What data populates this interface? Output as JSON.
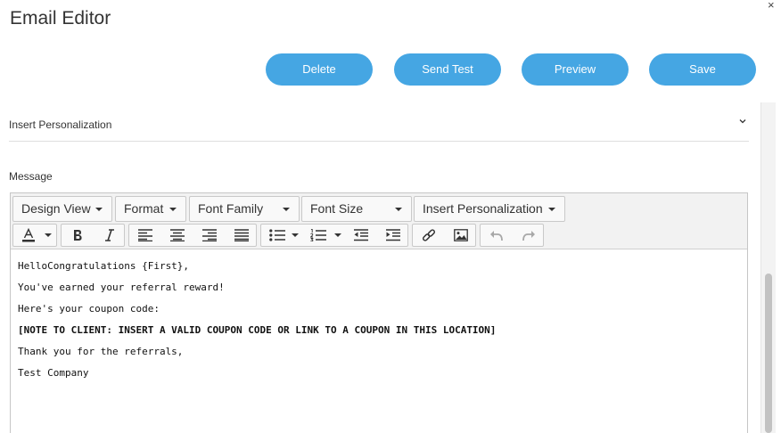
{
  "header": {
    "title": "Email Editor",
    "close_glyph": "×"
  },
  "actions": {
    "delete_label": "Delete",
    "send_test_label": "Send Test",
    "preview_label": "Preview",
    "save_label": "Save"
  },
  "personalization_panel": {
    "label": "Insert Personalization"
  },
  "message": {
    "label": "Message"
  },
  "toolbar": {
    "dropdowns": {
      "design_view": "Design View",
      "format": "Format",
      "font_family": "Font Family",
      "font_size": "Font Size",
      "insert_personalization": "Insert Personalization"
    },
    "icons": [
      "font-color-icon",
      "bold-icon",
      "italic-icon",
      "align-left-icon",
      "align-center-icon",
      "align-right-icon",
      "justify-icon",
      "bullet-list-icon",
      "numbered-list-icon",
      "outdent-icon",
      "indent-icon",
      "link-icon",
      "image-icon",
      "undo-icon",
      "redo-icon"
    ]
  },
  "editor_content": {
    "lines": [
      "HelloCongratulations {First},",
      "You've earned your referral reward!",
      "Here's your coupon code:",
      "[NOTE TO CLIENT: INSERT A VALID COUPON CODE OR LINK TO A COUPON IN THIS LOCATION]",
      "Thank you for the referrals,",
      "Test Company"
    ]
  },
  "colors": {
    "accent": "#45a6e3",
    "toolbar_bg": "#f2f2f2",
    "text": "#333333"
  }
}
